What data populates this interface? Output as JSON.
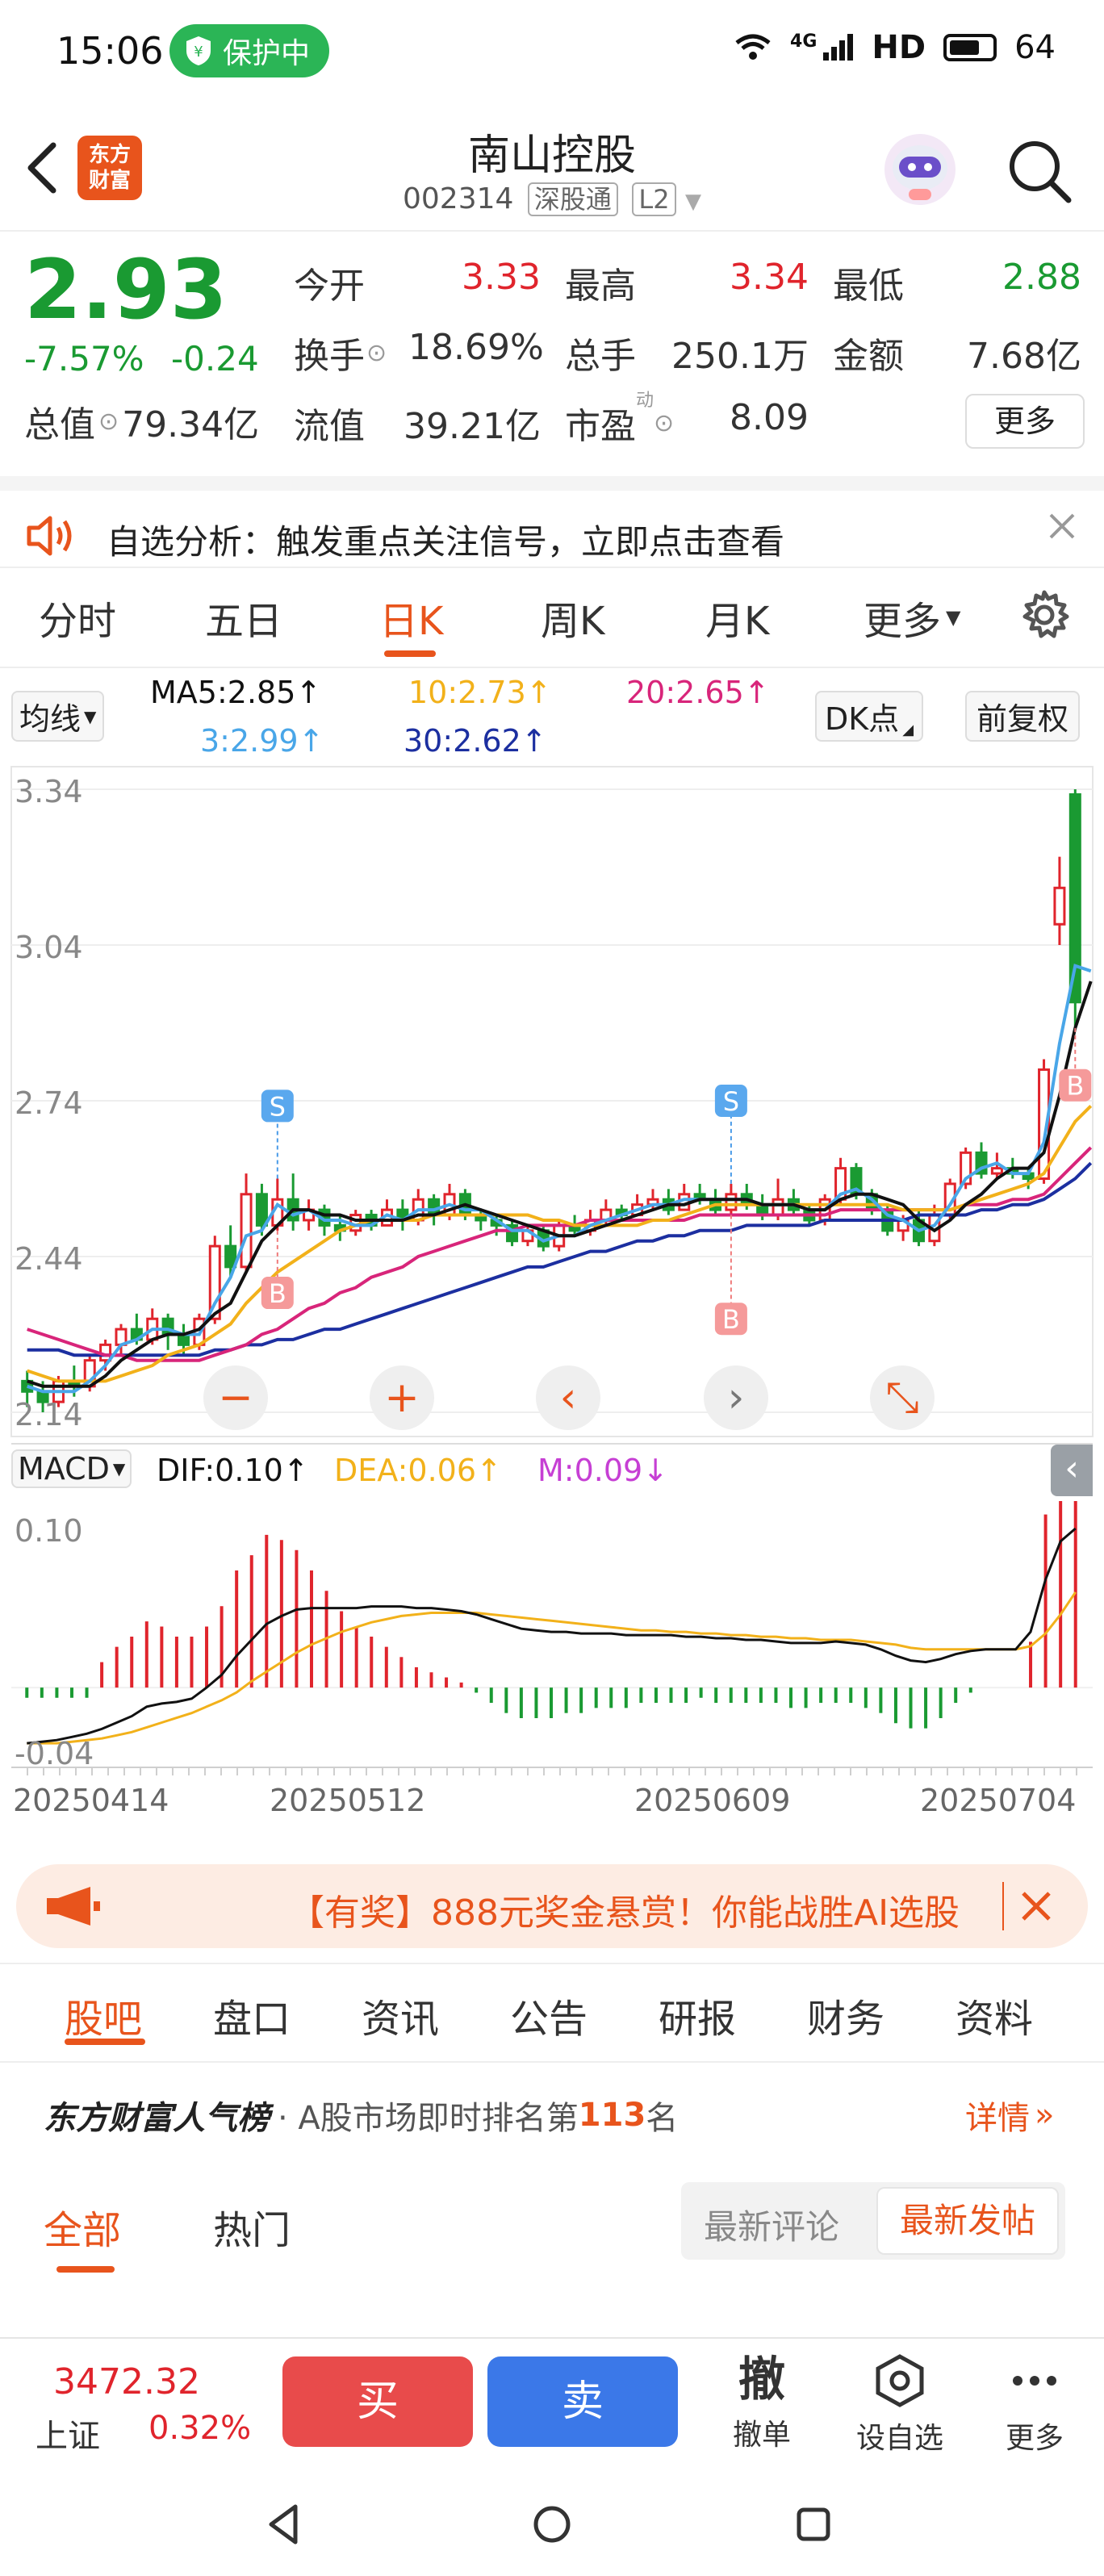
{
  "status_bar": {
    "time": "15:06",
    "protect_label": "保护中",
    "network": "4G",
    "hd": "HD",
    "battery": "64"
  },
  "header": {
    "title": "南山控股",
    "code": "002314",
    "market_tag": "深股通",
    "level_tag": "L2",
    "logo_line1": "东方",
    "logo_line2": "财富"
  },
  "quote": {
    "price": "2.93",
    "change_pct": "-7.57%",
    "change": "-0.24",
    "open_label": "今开",
    "open": "3.33",
    "high_label": "最高",
    "high": "3.34",
    "low_label": "最低",
    "low": "2.88",
    "turnover_label": "换手",
    "turnover": "18.69%",
    "volume_label": "总手",
    "volume": "250.1万",
    "amount_label": "金额",
    "amount": "7.68亿",
    "mktcap_label": "总值",
    "mktcap": "79.34亿",
    "float_label": "流值",
    "float_cap": "39.21亿",
    "pe_label": "市盈",
    "pe_sup": "动",
    "pe": "8.09",
    "more_label": "更多"
  },
  "notice": {
    "text": "自选分析：触发重点关注信号，立即点击查看"
  },
  "chart_tabs": [
    {
      "label": "分时"
    },
    {
      "label": "五日"
    },
    {
      "label": "日K"
    },
    {
      "label": "周K"
    },
    {
      "label": "月K"
    },
    {
      "label": "更多"
    }
  ],
  "active_tab": "日K",
  "ma_legend": {
    "selector": "均线",
    "ma5": "MA5:2.85↑",
    "ma10": "10:2.73↑",
    "ma20": "20:2.65↑",
    "ma3": "3:2.99↑",
    "ma30": "30:2.62↑",
    "dk_label": "DK点",
    "adjust_label": "前复权"
  },
  "macd_legend": {
    "selector": "MACD",
    "dif": "DIF:0.10↑",
    "dea": "DEA:0.06↑",
    "m": "M:0.09↓"
  },
  "colors": {
    "up": "#e0242c",
    "down": "#1a9a32",
    "ma5": "#111111",
    "ma10": "#f2b11a",
    "ma20": "#d8257a",
    "ma3": "#49a6e8",
    "ma30": "#1c2fa0",
    "accent": "#e8541c"
  },
  "chart_data": {
    "type": "candlestick",
    "y_ticks": [
      "3.34",
      "3.04",
      "2.74",
      "2.44",
      "2.14"
    ],
    "ylim": [
      2.14,
      3.34
    ],
    "macd_ticks": [
      "0.10",
      "-0.04"
    ],
    "macd_ylim": [
      -0.04,
      0.1
    ],
    "x_ticks": [
      "20250414",
      "20250512",
      "20250609",
      "20250704"
    ],
    "markers": [
      {
        "label": "S",
        "type": "sell"
      },
      {
        "label": "B",
        "type": "buy"
      },
      {
        "label": "S",
        "type": "sell"
      },
      {
        "label": "B",
        "type": "buy"
      },
      {
        "label": "B",
        "type": "buy"
      }
    ],
    "candles": [
      {
        "o": 2.2,
        "c": 2.18,
        "h": 2.22,
        "l": 2.15
      },
      {
        "o": 2.18,
        "c": 2.16,
        "h": 2.2,
        "l": 2.14
      },
      {
        "o": 2.16,
        "c": 2.2,
        "h": 2.21,
        "l": 2.15
      },
      {
        "o": 2.2,
        "c": 2.19,
        "h": 2.23,
        "l": 2.17
      },
      {
        "o": 2.19,
        "c": 2.24,
        "h": 2.25,
        "l": 2.18
      },
      {
        "o": 2.24,
        "c": 2.27,
        "h": 2.28,
        "l": 2.22
      },
      {
        "o": 2.27,
        "c": 2.3,
        "h": 2.31,
        "l": 2.25
      },
      {
        "o": 2.3,
        "c": 2.28,
        "h": 2.33,
        "l": 2.27
      },
      {
        "o": 2.28,
        "c": 2.32,
        "h": 2.34,
        "l": 2.27
      },
      {
        "o": 2.32,
        "c": 2.29,
        "h": 2.33,
        "l": 2.26
      },
      {
        "o": 2.29,
        "c": 2.27,
        "h": 2.31,
        "l": 2.25
      },
      {
        "o": 2.27,
        "c": 2.32,
        "h": 2.33,
        "l": 2.26
      },
      {
        "o": 2.32,
        "c": 2.46,
        "h": 2.48,
        "l": 2.31
      },
      {
        "o": 2.46,
        "c": 2.42,
        "h": 2.5,
        "l": 2.4
      },
      {
        "o": 2.42,
        "c": 2.56,
        "h": 2.6,
        "l": 2.41
      },
      {
        "o": 2.56,
        "c": 2.5,
        "h": 2.58,
        "l": 2.48
      },
      {
        "o": 2.5,
        "c": 2.55,
        "h": 2.59,
        "l": 2.49
      },
      {
        "o": 2.55,
        "c": 2.51,
        "h": 2.6,
        "l": 2.49
      },
      {
        "o": 2.51,
        "c": 2.53,
        "h": 2.55,
        "l": 2.49
      },
      {
        "o": 2.53,
        "c": 2.5,
        "h": 2.54,
        "l": 2.48
      },
      {
        "o": 2.5,
        "c": 2.49,
        "h": 2.52,
        "l": 2.47
      },
      {
        "o": 2.49,
        "c": 2.52,
        "h": 2.53,
        "l": 2.48
      },
      {
        "o": 2.52,
        "c": 2.5,
        "h": 2.53,
        "l": 2.49
      },
      {
        "o": 2.5,
        "c": 2.53,
        "h": 2.55,
        "l": 2.5
      },
      {
        "o": 2.53,
        "c": 2.51,
        "h": 2.55,
        "l": 2.49
      },
      {
        "o": 2.51,
        "c": 2.55,
        "h": 2.57,
        "l": 2.5
      },
      {
        "o": 2.55,
        "c": 2.52,
        "h": 2.56,
        "l": 2.5
      },
      {
        "o": 2.52,
        "c": 2.56,
        "h": 2.58,
        "l": 2.51
      },
      {
        "o": 2.56,
        "c": 2.52,
        "h": 2.57,
        "l": 2.51
      },
      {
        "o": 2.52,
        "c": 2.51,
        "h": 2.53,
        "l": 2.49
      },
      {
        "o": 2.51,
        "c": 2.5,
        "h": 2.52,
        "l": 2.48
      },
      {
        "o": 2.5,
        "c": 2.47,
        "h": 2.51,
        "l": 2.46
      },
      {
        "o": 2.47,
        "c": 2.49,
        "h": 2.5,
        "l": 2.46
      },
      {
        "o": 2.49,
        "c": 2.46,
        "h": 2.5,
        "l": 2.45
      },
      {
        "o": 2.46,
        "c": 2.5,
        "h": 2.51,
        "l": 2.45
      },
      {
        "o": 2.5,
        "c": 2.49,
        "h": 2.52,
        "l": 2.48
      },
      {
        "o": 2.49,
        "c": 2.51,
        "h": 2.53,
        "l": 2.48
      },
      {
        "o": 2.51,
        "c": 2.53,
        "h": 2.55,
        "l": 2.5
      },
      {
        "o": 2.53,
        "c": 2.52,
        "h": 2.54,
        "l": 2.51
      },
      {
        "o": 2.52,
        "c": 2.54,
        "h": 2.56,
        "l": 2.52
      },
      {
        "o": 2.54,
        "c": 2.55,
        "h": 2.57,
        "l": 2.53
      },
      {
        "o": 2.55,
        "c": 2.53,
        "h": 2.57,
        "l": 2.52
      },
      {
        "o": 2.53,
        "c": 2.56,
        "h": 2.58,
        "l": 2.53
      },
      {
        "o": 2.56,
        "c": 2.55,
        "h": 2.58,
        "l": 2.54
      },
      {
        "o": 2.55,
        "c": 2.53,
        "h": 2.57,
        "l": 2.52
      },
      {
        "o": 2.53,
        "c": 2.56,
        "h": 2.58,
        "l": 2.52
      },
      {
        "o": 2.56,
        "c": 2.54,
        "h": 2.58,
        "l": 2.53
      },
      {
        "o": 2.54,
        "c": 2.52,
        "h": 2.56,
        "l": 2.51
      },
      {
        "o": 2.52,
        "c": 2.55,
        "h": 2.59,
        "l": 2.51
      },
      {
        "o": 2.55,
        "c": 2.53,
        "h": 2.57,
        "l": 2.52
      },
      {
        "o": 2.53,
        "c": 2.51,
        "h": 2.54,
        "l": 2.5
      },
      {
        "o": 2.51,
        "c": 2.55,
        "h": 2.56,
        "l": 2.5
      },
      {
        "o": 2.55,
        "c": 2.61,
        "h": 2.63,
        "l": 2.54
      },
      {
        "o": 2.61,
        "c": 2.56,
        "h": 2.62,
        "l": 2.55
      },
      {
        "o": 2.56,
        "c": 2.53,
        "h": 2.57,
        "l": 2.52
      },
      {
        "o": 2.53,
        "c": 2.49,
        "h": 2.54,
        "l": 2.48
      },
      {
        "o": 2.49,
        "c": 2.51,
        "h": 2.52,
        "l": 2.47
      },
      {
        "o": 2.51,
        "c": 2.47,
        "h": 2.53,
        "l": 2.46
      },
      {
        "o": 2.47,
        "c": 2.52,
        "h": 2.54,
        "l": 2.46
      },
      {
        "o": 2.52,
        "c": 2.58,
        "h": 2.59,
        "l": 2.51
      },
      {
        "o": 2.58,
        "c": 2.64,
        "h": 2.65,
        "l": 2.57
      },
      {
        "o": 2.64,
        "c": 2.6,
        "h": 2.66,
        "l": 2.59
      },
      {
        "o": 2.6,
        "c": 2.61,
        "h": 2.64,
        "l": 2.59
      },
      {
        "o": 2.61,
        "c": 2.6,
        "h": 2.63,
        "l": 2.59
      },
      {
        "o": 2.6,
        "c": 2.59,
        "h": 2.61,
        "l": 2.57
      },
      {
        "o": 2.59,
        "c": 2.8,
        "h": 2.82,
        "l": 2.58
      },
      {
        "o": 3.08,
        "c": 3.15,
        "h": 3.21,
        "l": 3.04
      },
      {
        "o": 3.33,
        "c": 2.93,
        "h": 3.34,
        "l": 2.88
      }
    ],
    "ma5": [
      2.2,
      2.19,
      2.19,
      2.19,
      2.19,
      2.21,
      2.24,
      2.26,
      2.28,
      2.29,
      2.29,
      2.3,
      2.33,
      2.35,
      2.41,
      2.47,
      2.5,
      2.53,
      2.53,
      2.52,
      2.52,
      2.51,
      2.51,
      2.51,
      2.51,
      2.52,
      2.52,
      2.53,
      2.54,
      2.53,
      2.52,
      2.51,
      2.5,
      2.49,
      2.48,
      2.48,
      2.49,
      2.5,
      2.51,
      2.52,
      2.53,
      2.54,
      2.54,
      2.55,
      2.55,
      2.55,
      2.55,
      2.54,
      2.54,
      2.54,
      2.53,
      2.53,
      2.55,
      2.56,
      2.56,
      2.55,
      2.54,
      2.51,
      2.49,
      2.51,
      2.54,
      2.56,
      2.59,
      2.61,
      2.61,
      2.64,
      2.75,
      2.88,
      2.97
    ],
    "ma10": [
      2.22,
      2.21,
      2.2,
      2.2,
      2.2,
      2.2,
      2.21,
      2.22,
      2.23,
      2.25,
      2.26,
      2.27,
      2.29,
      2.31,
      2.35,
      2.38,
      2.41,
      2.43,
      2.45,
      2.47,
      2.49,
      2.5,
      2.51,
      2.51,
      2.51,
      2.51,
      2.52,
      2.52,
      2.52,
      2.52,
      2.52,
      2.52,
      2.52,
      2.51,
      2.51,
      2.5,
      2.5,
      2.5,
      2.5,
      2.5,
      2.51,
      2.51,
      2.52,
      2.53,
      2.54,
      2.54,
      2.54,
      2.54,
      2.54,
      2.54,
      2.54,
      2.54,
      2.54,
      2.54,
      2.54,
      2.54,
      2.53,
      2.53,
      2.53,
      2.53,
      2.54,
      2.55,
      2.56,
      2.57,
      2.58,
      2.6,
      2.65,
      2.7,
      2.73
    ],
    "ma20": [
      2.3,
      2.29,
      2.28,
      2.27,
      2.26,
      2.25,
      2.25,
      2.24,
      2.24,
      2.24,
      2.24,
      2.24,
      2.25,
      2.26,
      2.27,
      2.29,
      2.3,
      2.32,
      2.34,
      2.35,
      2.37,
      2.38,
      2.4,
      2.41,
      2.42,
      2.44,
      2.45,
      2.46,
      2.47,
      2.48,
      2.49,
      2.49,
      2.5,
      2.5,
      2.5,
      2.5,
      2.51,
      2.51,
      2.51,
      2.51,
      2.51,
      2.51,
      2.51,
      2.52,
      2.52,
      2.52,
      2.52,
      2.52,
      2.52,
      2.52,
      2.52,
      2.52,
      2.53,
      2.53,
      2.53,
      2.53,
      2.53,
      2.53,
      2.53,
      2.53,
      2.54,
      2.54,
      2.54,
      2.55,
      2.55,
      2.56,
      2.59,
      2.62,
      2.65
    ],
    "ma30": [
      2.26,
      2.26,
      2.26,
      2.25,
      2.25,
      2.25,
      2.25,
      2.25,
      2.25,
      2.25,
      2.25,
      2.25,
      2.26,
      2.26,
      2.27,
      2.27,
      2.28,
      2.28,
      2.29,
      2.3,
      2.3,
      2.31,
      2.32,
      2.33,
      2.34,
      2.35,
      2.36,
      2.37,
      2.38,
      2.39,
      2.4,
      2.41,
      2.42,
      2.42,
      2.43,
      2.44,
      2.45,
      2.45,
      2.46,
      2.47,
      2.47,
      2.48,
      2.48,
      2.49,
      2.49,
      2.49,
      2.5,
      2.5,
      2.5,
      2.5,
      2.5,
      2.51,
      2.51,
      2.51,
      2.51,
      2.51,
      2.51,
      2.52,
      2.52,
      2.52,
      2.52,
      2.53,
      2.53,
      2.54,
      2.54,
      2.55,
      2.57,
      2.59,
      2.62
    ],
    "ma3": [
      2.19,
      2.18,
      2.18,
      2.18,
      2.2,
      2.23,
      2.27,
      2.28,
      2.3,
      2.3,
      2.29,
      2.29,
      2.35,
      2.4,
      2.48,
      2.49,
      2.54,
      2.52,
      2.53,
      2.51,
      2.51,
      2.5,
      2.5,
      2.52,
      2.51,
      2.53,
      2.53,
      2.54,
      2.53,
      2.53,
      2.51,
      2.49,
      2.49,
      2.47,
      2.48,
      2.48,
      2.5,
      2.51,
      2.52,
      2.53,
      2.54,
      2.54,
      2.55,
      2.55,
      2.55,
      2.55,
      2.55,
      2.54,
      2.54,
      2.54,
      2.53,
      2.53,
      2.56,
      2.57,
      2.55,
      2.52,
      2.51,
      2.49,
      2.5,
      2.54,
      2.59,
      2.61,
      2.62,
      2.6,
      2.6,
      2.66,
      2.85,
      3.0,
      2.99
    ],
    "macd": {
      "dif": [
        -0.035,
        -0.034,
        -0.033,
        -0.031,
        -0.029,
        -0.026,
        -0.022,
        -0.018,
        -0.012,
        -0.01,
        -0.009,
        -0.007,
        0.0,
        0.008,
        0.02,
        0.03,
        0.04,
        0.045,
        0.049,
        0.05,
        0.05,
        0.05,
        0.05,
        0.051,
        0.051,
        0.051,
        0.05,
        0.05,
        0.049,
        0.048,
        0.046,
        0.043,
        0.04,
        0.037,
        0.036,
        0.035,
        0.035,
        0.034,
        0.034,
        0.034,
        0.033,
        0.033,
        0.033,
        0.033,
        0.032,
        0.032,
        0.031,
        0.031,
        0.03,
        0.03,
        0.029,
        0.028,
        0.028,
        0.028,
        0.029,
        0.028,
        0.027,
        0.024,
        0.02,
        0.017,
        0.016,
        0.018,
        0.021,
        0.023,
        0.024,
        0.024,
        0.024,
        0.035,
        0.068,
        0.092,
        0.1
      ],
      "dea": [
        -0.035,
        -0.035,
        -0.035,
        -0.034,
        -0.033,
        -0.032,
        -0.03,
        -0.028,
        -0.025,
        -0.022,
        -0.019,
        -0.016,
        -0.012,
        -0.008,
        -0.003,
        0.004,
        0.01,
        0.016,
        0.022,
        0.027,
        0.031,
        0.035,
        0.038,
        0.041,
        0.043,
        0.045,
        0.046,
        0.047,
        0.047,
        0.047,
        0.047,
        0.046,
        0.045,
        0.044,
        0.043,
        0.042,
        0.041,
        0.04,
        0.039,
        0.038,
        0.037,
        0.036,
        0.036,
        0.035,
        0.035,
        0.034,
        0.034,
        0.033,
        0.033,
        0.032,
        0.032,
        0.031,
        0.031,
        0.03,
        0.03,
        0.03,
        0.029,
        0.028,
        0.027,
        0.025,
        0.024,
        0.024,
        0.024,
        0.024,
        0.024,
        0.024,
        0.024,
        0.026,
        0.034,
        0.046,
        0.06
      ],
      "m": [
        -0.004,
        -0.004,
        -0.004,
        -0.004,
        -0.004,
        0.01,
        0.016,
        0.02,
        0.026,
        0.024,
        0.02,
        0.02,
        0.024,
        0.032,
        0.046,
        0.052,
        0.06,
        0.058,
        0.054,
        0.046,
        0.038,
        0.03,
        0.024,
        0.02,
        0.016,
        0.012,
        0.008,
        0.006,
        0.004,
        0.002,
        -0.002,
        -0.006,
        -0.01,
        -0.012,
        -0.012,
        -0.012,
        -0.01,
        -0.01,
        -0.008,
        -0.008,
        -0.008,
        -0.006,
        -0.006,
        -0.006,
        -0.006,
        -0.004,
        -0.006,
        -0.006,
        -0.006,
        -0.006,
        -0.006,
        -0.008,
        -0.008,
        -0.006,
        -0.006,
        -0.006,
        -0.008,
        -0.01,
        -0.014,
        -0.016,
        -0.016,
        -0.012,
        -0.006,
        -0.002,
        0.0,
        0.0,
        0.0,
        0.018,
        0.068,
        0.092,
        0.08
      ]
    }
  },
  "chart_buttons": [
    {
      "name": "zoom-out",
      "glyph": "−"
    },
    {
      "name": "zoom-in",
      "glyph": "+"
    },
    {
      "name": "pan-left",
      "glyph": "‹"
    },
    {
      "name": "pan-right",
      "glyph": "›"
    },
    {
      "name": "fullscreen",
      "glyph": "⤡"
    }
  ],
  "ad_banner": {
    "text": "【有奖】888元奖金悬赏！你能战胜AI选股"
  },
  "section_tabs": [
    {
      "label": "股吧"
    },
    {
      "label": "盘口"
    },
    {
      "label": "资讯"
    },
    {
      "label": "公告"
    },
    {
      "label": "研报"
    },
    {
      "label": "财务"
    },
    {
      "label": "资料"
    }
  ],
  "active_section": "股吧",
  "ranking": {
    "brand": "东方财富人气榜",
    "prefix": "· A股市场即时排名第",
    "rank": "113",
    "suffix": "名",
    "detail": "详情"
  },
  "feed_tabs": [
    {
      "label": "全部"
    },
    {
      "label": "热门"
    }
  ],
  "sort_options": {
    "latest_comment": "最新评论",
    "latest_post": "最新发帖"
  },
  "bottom_bar": {
    "index_value": "3472.32",
    "index_name": "上证",
    "index_change": "0.32%",
    "buy": "买",
    "sell": "卖",
    "cancel_icon": "撤",
    "cancel": "撤单",
    "watch": "设自选",
    "more": "更多"
  }
}
